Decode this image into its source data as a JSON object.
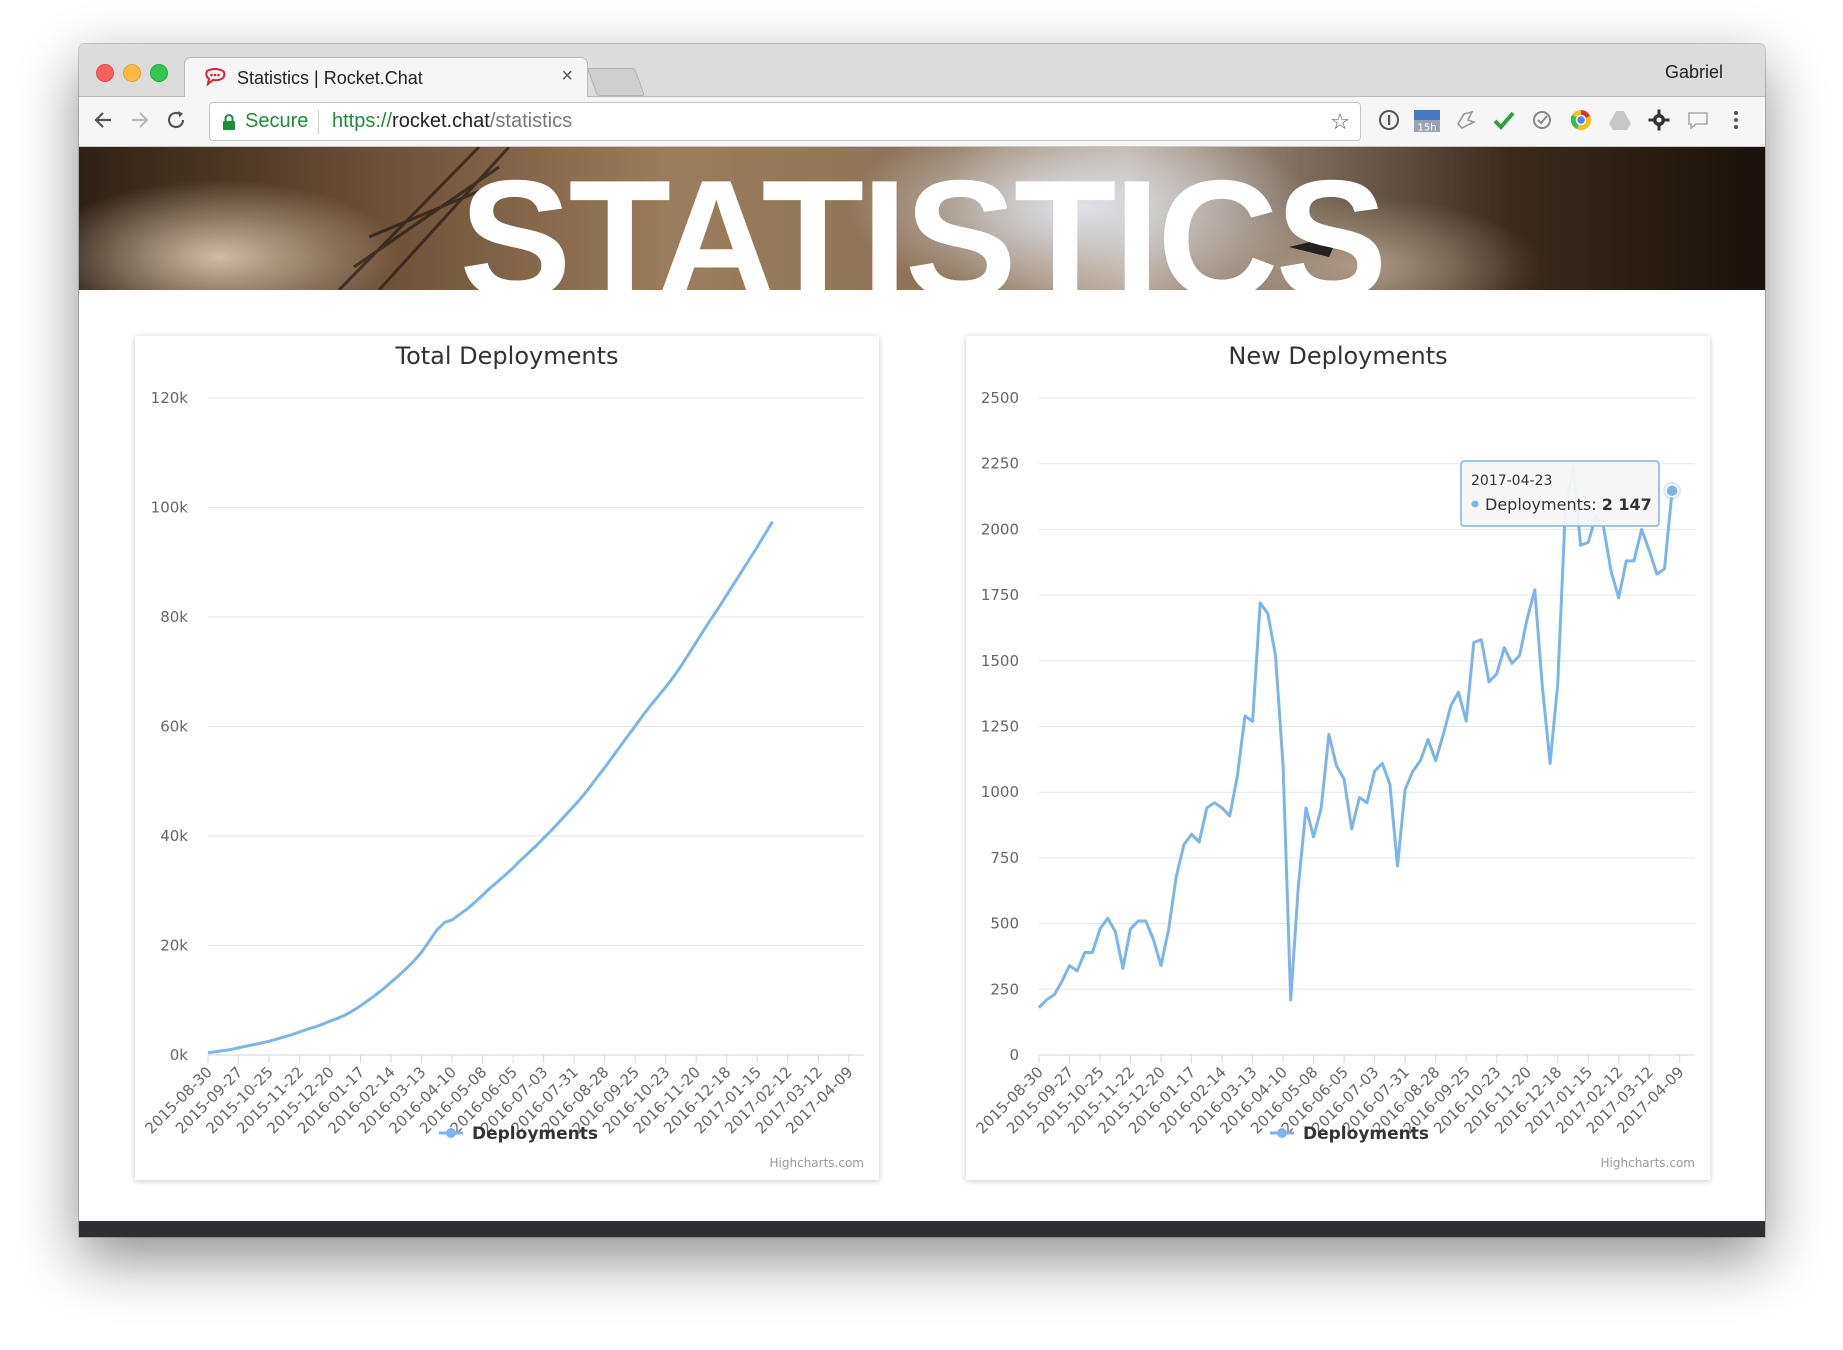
{
  "browser": {
    "tab_title": "Statistics | Rocket.Chat",
    "tab_close": "×",
    "profile_name": "Gabriel",
    "secure_label": "Secure",
    "url_scheme": "https://",
    "url_host": "rocket.chat",
    "url_path": "/statistics",
    "bookmark_star": "☆",
    "extensions": [
      "info-icon",
      "calendar-icon",
      "bird-icon",
      "check-icon",
      "circle-check-icon",
      "chrome-icon",
      "drive-icon",
      "gear-icon",
      "chat-bubble-icon",
      "more-menu-icon"
    ],
    "calendar_badge": "15h"
  },
  "hero": {
    "title": "STATISTICS"
  },
  "colors": {
    "series": "#7cb5ec",
    "grid": "#e6e6e6",
    "secure_green": "#1d8e37"
  },
  "chart_data": [
    {
      "type": "line",
      "title": "Total Deployments",
      "ylim": [
        0,
        120000
      ],
      "yticks": [
        {
          "value": 0,
          "label": "0k"
        },
        {
          "value": 20000,
          "label": "20k"
        },
        {
          "value": 40000,
          "label": "40k"
        },
        {
          "value": 60000,
          "label": "60k"
        },
        {
          "value": 80000,
          "label": "80k"
        },
        {
          "value": 100000,
          "label": "100k"
        },
        {
          "value": 120000,
          "label": "120k"
        }
      ],
      "xticks": [
        "2015-08-30",
        "2015-09-27",
        "2015-10-25",
        "2015-11-22",
        "2015-12-20",
        "2016-01-17",
        "2016-02-14",
        "2016-03-13",
        "2016-04-10",
        "2016-05-08",
        "2016-06-05",
        "2016-07-03",
        "2016-07-31",
        "2016-08-28",
        "2016-09-25",
        "2016-10-23",
        "2016-11-20",
        "2016-12-18",
        "2017-01-15",
        "2017-02-12",
        "2017-03-12",
        "2017-04-09"
      ],
      "xrange": [
        0,
        86
      ],
      "legend": "Deployments",
      "grid": true,
      "credits": "Highcharts.com",
      "series": [
        {
          "name": "Deployments",
          "values": [
            400,
            600,
            800,
            1000,
            1300,
            1600,
            1900,
            2200,
            2500,
            2900,
            3300,
            3700,
            4200,
            4700,
            5100,
            5600,
            6200,
            6700,
            7300,
            8100,
            9000,
            10000,
            11000,
            12100,
            13300,
            14500,
            15800,
            17200,
            18800,
            20800,
            22800,
            24200,
            24700,
            25700,
            26700,
            27900,
            29200,
            30500,
            31700,
            32900,
            34200,
            35600,
            36900,
            38200,
            39600,
            41000,
            42500,
            44000,
            45500,
            47100,
            48800,
            50700,
            52500,
            54400,
            56300,
            58200,
            60100,
            62000,
            63800,
            65500,
            67200,
            69000,
            71000,
            73200,
            75400,
            77600,
            79700,
            81800,
            84000,
            86200,
            88400,
            90600,
            92800,
            95100,
            97400
          ]
        }
      ]
    },
    {
      "type": "line",
      "title": "New Deployments",
      "ylim": [
        0,
        2500
      ],
      "yticks": [
        {
          "value": 0,
          "label": "0"
        },
        {
          "value": 250,
          "label": "250"
        },
        {
          "value": 500,
          "label": "500"
        },
        {
          "value": 750,
          "label": "750"
        },
        {
          "value": 1000,
          "label": "1000"
        },
        {
          "value": 1250,
          "label": "1250"
        },
        {
          "value": 1500,
          "label": "1500"
        },
        {
          "value": 1750,
          "label": "1750"
        },
        {
          "value": 2000,
          "label": "2000"
        },
        {
          "value": 2250,
          "label": "2250"
        },
        {
          "value": 2500,
          "label": "2500"
        }
      ],
      "xticks": [
        "2015-08-30",
        "2015-09-27",
        "2015-10-25",
        "2015-11-22",
        "2015-12-20",
        "2016-01-17",
        "2016-02-14",
        "2016-03-13",
        "2016-04-10",
        "2016-05-08",
        "2016-06-05",
        "2016-07-03",
        "2016-07-31",
        "2016-08-28",
        "2016-09-25",
        "2016-10-23",
        "2016-11-20",
        "2016-12-18",
        "2017-01-15",
        "2017-02-12",
        "2017-03-12",
        "2017-04-09"
      ],
      "xrange": [
        0,
        86
      ],
      "legend": "Deployments",
      "grid": true,
      "credits": "Highcharts.com",
      "series": [
        {
          "name": "Deployments",
          "values": [
            180,
            210,
            230,
            280,
            340,
            320,
            390,
            390,
            480,
            520,
            470,
            330,
            480,
            510,
            510,
            440,
            340,
            480,
            680,
            800,
            840,
            810,
            940,
            960,
            940,
            910,
            1060,
            1290,
            1270,
            1720,
            1680,
            1520,
            1100,
            210,
            640,
            940,
            830,
            940,
            1220,
            1100,
            1050,
            860,
            980,
            960,
            1080,
            1110,
            1030,
            720,
            1010,
            1080,
            1120,
            1200,
            1120,
            1220,
            1330,
            1380,
            1270,
            1570,
            1580,
            1420,
            1450,
            1550,
            1490,
            1520,
            1660,
            1770,
            1400,
            1110,
            1410,
            2070,
            2240,
            1940,
            1950,
            2050,
            2010,
            1840,
            1740,
            1880,
            1880,
            2000,
            1920,
            1830,
            1850,
            2147
          ],
          "tooltip": {
            "date": "2017-04-23",
            "label": "Deployments",
            "value": "2 147"
          }
        }
      ]
    }
  ]
}
